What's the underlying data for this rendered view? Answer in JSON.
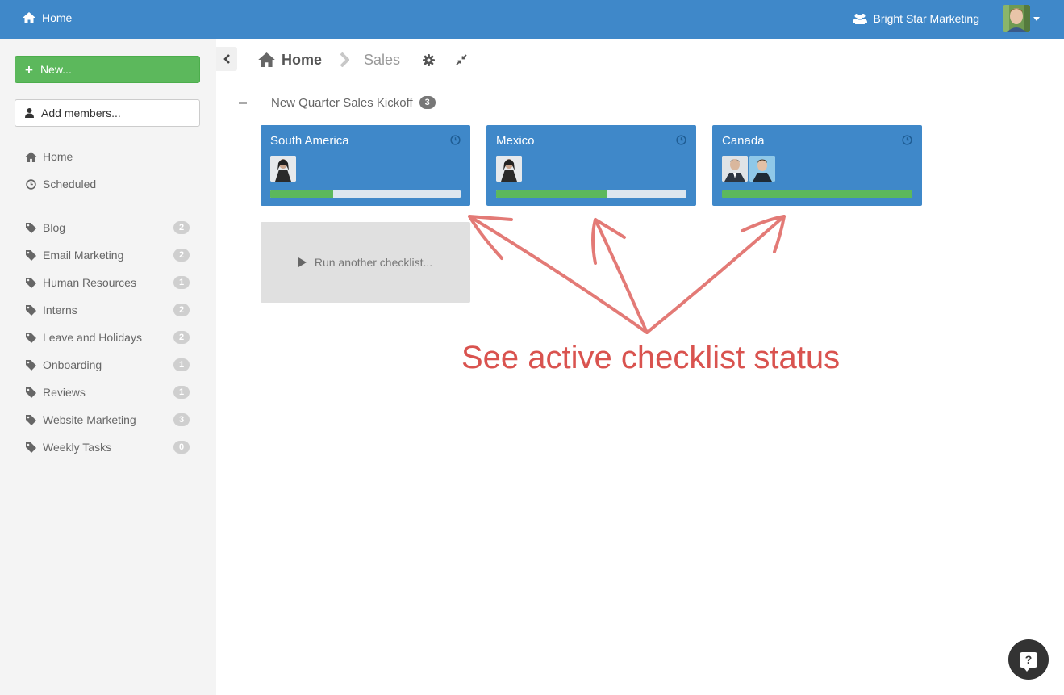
{
  "topbar": {
    "home_label": "Home",
    "org_label": "Bright Star Marketing"
  },
  "sidebar": {
    "new_label": "New...",
    "add_members_label": "Add members...",
    "primary": [
      {
        "label": "Home",
        "icon": "home-icon"
      },
      {
        "label": "Scheduled",
        "icon": "clock-icon"
      }
    ],
    "tags": [
      {
        "label": "Blog",
        "count": "2"
      },
      {
        "label": "Email Marketing",
        "count": "2"
      },
      {
        "label": "Human Resources",
        "count": "1"
      },
      {
        "label": "Interns",
        "count": "2"
      },
      {
        "label": "Leave and Holidays",
        "count": "2"
      },
      {
        "label": "Onboarding",
        "count": "1"
      },
      {
        "label": "Reviews",
        "count": "1"
      },
      {
        "label": "Website Marketing",
        "count": "3"
      },
      {
        "label": "Weekly Tasks",
        "count": "0"
      }
    ]
  },
  "breadcrumb": {
    "home": "Home",
    "current": "Sales"
  },
  "group": {
    "title": "New Quarter Sales Kickoff",
    "count": "3"
  },
  "cards": [
    {
      "title": "South America",
      "progress": 0.33,
      "avatars": [
        "woman-avatar"
      ]
    },
    {
      "title": "Mexico",
      "progress": 0.58,
      "avatars": [
        "woman-avatar"
      ]
    },
    {
      "title": "Canada",
      "progress": 1.0,
      "avatars": [
        "man-suit-avatar",
        "man-avatar"
      ]
    }
  ],
  "run_label": "Run another checklist...",
  "annotation": "See active checklist status",
  "colors": {
    "topbar": "#3f88c9",
    "card": "#3f88c9",
    "progress": "#5cb85c",
    "new_button": "#5cb85c",
    "annotation": "#d9534f"
  }
}
